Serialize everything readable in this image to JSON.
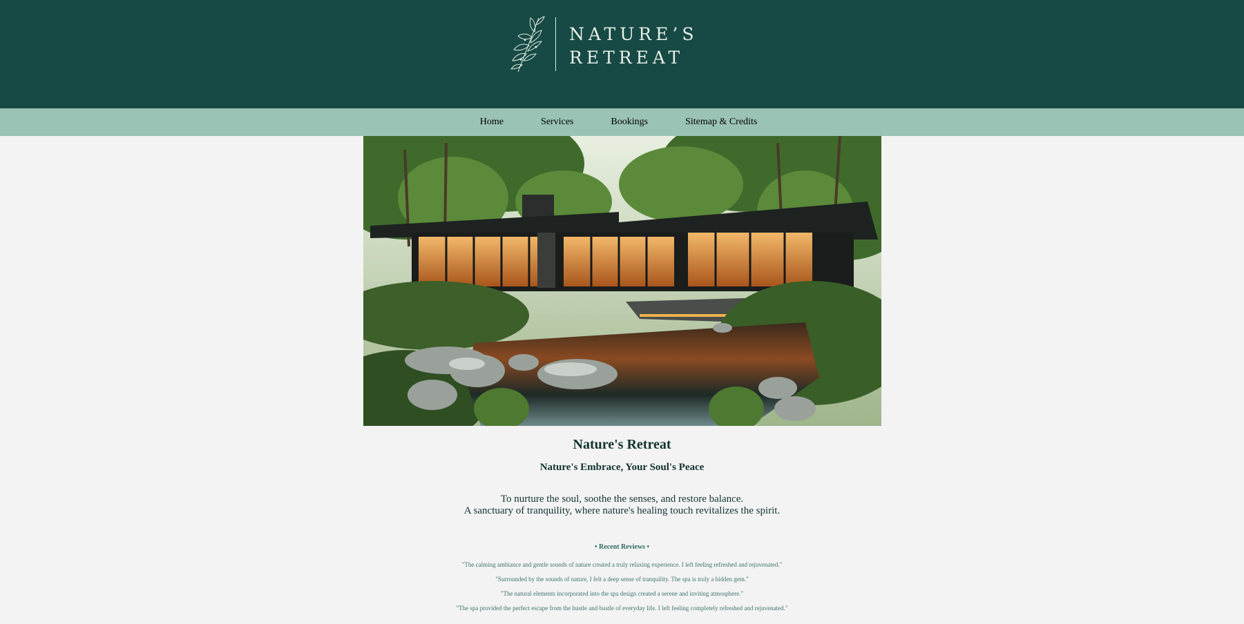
{
  "brand": {
    "line1": "NATURE’S",
    "line2": "RETREAT"
  },
  "nav": {
    "items": [
      "Home",
      "Services",
      "Bookings",
      "Sitemap & Credits"
    ]
  },
  "hero": {
    "alt": "Modern glass house beside a forest pond at dusk"
  },
  "main": {
    "title": "Nature's Retreat",
    "tagline": "Nature's Embrace, Your Soul's Peace",
    "mission_line1": "To nurture the soul, soothe the senses, and restore balance.",
    "mission_line2": "A sanctuary of tranquility, where nature's healing touch revitalizes the spirit."
  },
  "reviews": {
    "heading": "• Recent Reviews •",
    "items": [
      "\"The calming ambiance and gentle sounds of nature created a truly relaxing experience. I left feeling refreshed and rejuvenated.\"",
      "\"Surrounded by the sounds of nature, I felt a deep sense of tranquility. The spa is truly a hidden gem.\"",
      "\"The natural elements incorporated into the spa design created a serene and inviting atmosphere.\"",
      "\"The spa provided the perfect escape from the hustle and bustle of everyday life. I left feeling completely refreshed and rejuvenated.\""
    ]
  },
  "colors": {
    "header_bg": "#174a44",
    "nav_bg": "#9ac3b5",
    "page_bg": "#f3f3f3",
    "accent_text": "#2f6b5f"
  },
  "icons": {
    "logo": "olive-sprig-icon"
  }
}
